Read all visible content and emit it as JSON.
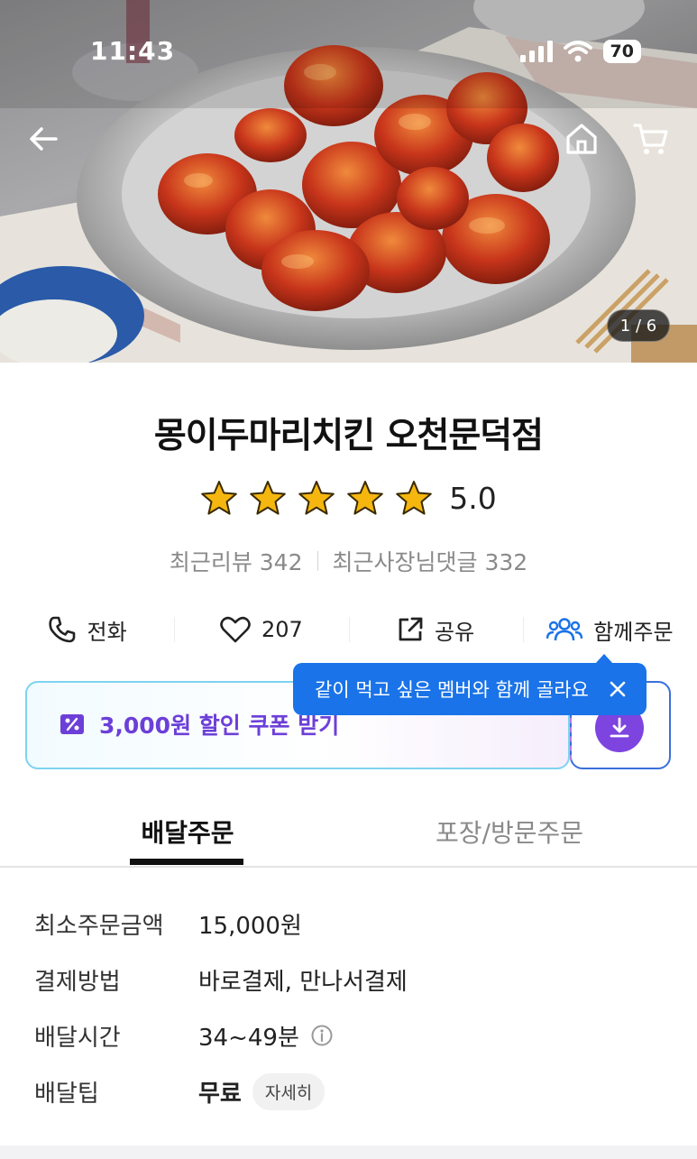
{
  "status_bar": {
    "time": "11:43",
    "battery": "70"
  },
  "hero": {
    "image_counter": "1 / 6",
    "icons": [
      "back-arrow-icon",
      "home-icon",
      "cart-icon"
    ]
  },
  "store": {
    "name": "몽이두마리치킨 오천문덕점",
    "rating": "5.0",
    "star_count": 5,
    "recent_reviews": "최근리뷰 342",
    "owner_replies": "최근사장님댓글 332"
  },
  "actions": {
    "call": "전화",
    "likes": "207",
    "share": "공유",
    "group_order": "함께주문"
  },
  "tooltip": {
    "text": "같이 먹고 싶은 멤버와 함께 골라요"
  },
  "coupon": {
    "label": "3,000원 할인 쿠폰 받기"
  },
  "tabs": {
    "delivery": "배달주문",
    "pickup": "포장/방문주문"
  },
  "info": {
    "min_order_label": "최소주문금액",
    "min_order_value": "15,000원",
    "payment_label": "결제방법",
    "payment_value": "바로결제, 만나서결제",
    "delivery_time_label": "배달시간",
    "delivery_time_value": "34~49분",
    "delivery_tip_label": "배달팁",
    "delivery_tip_value": "무료",
    "details_chip": "자세히"
  },
  "colors": {
    "accent_blue": "#1a73e8",
    "coupon_purple": "#6c3fd8",
    "star_yellow": "#f5b70f"
  }
}
